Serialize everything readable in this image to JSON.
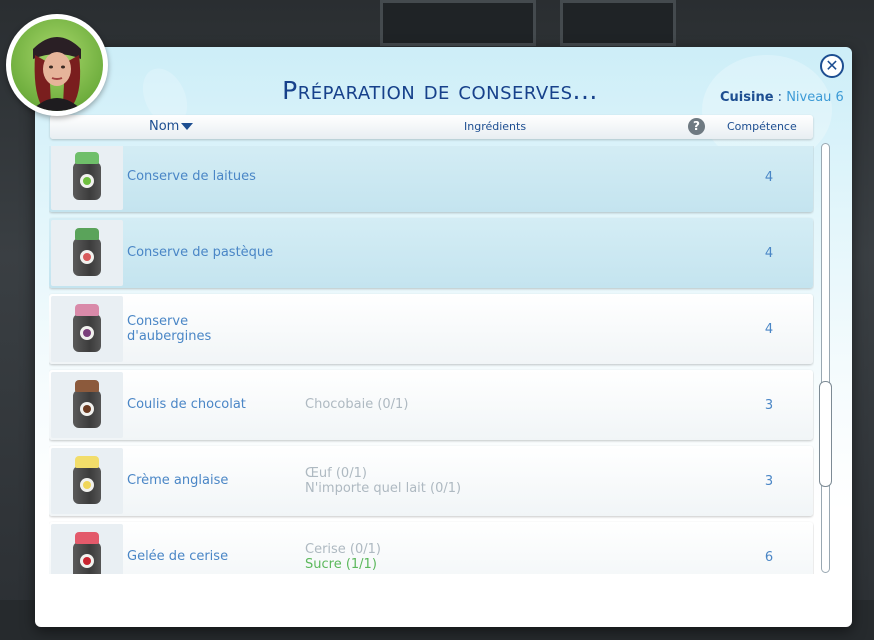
{
  "dialog": {
    "title": "Préparation de conserves...",
    "skill": {
      "label": "Cuisine",
      "separator": " : ",
      "level": "Niveau 6"
    }
  },
  "table": {
    "columns": {
      "name": "Nom",
      "ingredients": "Ingrédients",
      "help": "?",
      "competence": "Compétence"
    },
    "rows": [
      {
        "name": "Conserve de laitues",
        "ingredients": [],
        "competence": "4",
        "jar_lid": "#6fbf6a",
        "fruit": "#6fbf3f"
      },
      {
        "name": "Conserve de pastèque",
        "ingredients": [],
        "competence": "4",
        "jar_lid": "#5aa35a",
        "fruit": "#d85a5a"
      },
      {
        "name": "Conserve\nd'aubergines",
        "ingredients": [],
        "competence": "4",
        "jar_lid": "#d98aa9",
        "fruit": "#7a3f7a"
      },
      {
        "name": "Coulis de chocolat",
        "ingredients": [
          {
            "text": "Chocobaie (0/1)",
            "ok": false
          }
        ],
        "competence": "3",
        "jar_lid": "#8c5a3c",
        "fruit": "#6b3b22"
      },
      {
        "name": "Crème anglaise",
        "ingredients": [
          {
            "text": "Œuf (0/1)",
            "ok": false
          },
          {
            "text": "N'importe quel lait (0/1)",
            "ok": false
          }
        ],
        "competence": "3",
        "jar_lid": "#f2dd6a",
        "fruit": "#f0d65a"
      },
      {
        "name": "Gelée de cerise",
        "ingredients": [
          {
            "text": "Cerise (0/1)",
            "ok": false
          },
          {
            "text": "Sucre (1/1)",
            "ok": true
          }
        ],
        "competence": "6",
        "jar_lid": "#e35a6b",
        "fruit": "#c8242f"
      }
    ]
  },
  "colors": {
    "title": "#17418b",
    "accent": "#4a86c6",
    "ok": "#5cb85c",
    "muted": "#aeb9c1"
  },
  "icons": {
    "close": "close-icon",
    "help": "help-icon",
    "sort": "sort-down-icon",
    "avatar": "sim-portrait"
  }
}
